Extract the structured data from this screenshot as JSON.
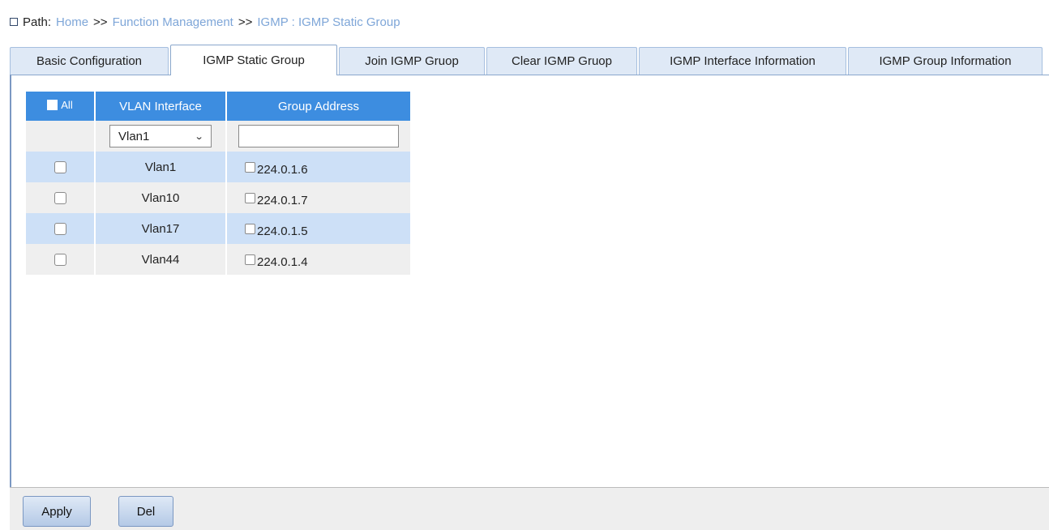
{
  "path": {
    "label": "Path:",
    "crumbs": [
      "Home",
      "Function Management",
      "IGMP : IGMP Static Group"
    ],
    "separator": ">>"
  },
  "tabs": [
    {
      "label": "Basic Configuration",
      "active": false
    },
    {
      "label": "IGMP Static Group",
      "active": true
    },
    {
      "label": "Join IGMP Gruop",
      "active": false
    },
    {
      "label": "Clear IGMP Gruop",
      "active": false
    },
    {
      "label": "IGMP Interface Information",
      "active": false
    },
    {
      "label": "IGMP Group Information",
      "active": false
    }
  ],
  "table": {
    "headers": {
      "all": "All",
      "vlan": "VLAN Interface",
      "group": "Group Address"
    },
    "input_row": {
      "vlan_select": "Vlan1",
      "group_input": ""
    },
    "rows": [
      {
        "vlan": "Vlan1",
        "group": "224.0.1.6"
      },
      {
        "vlan": "Vlan10",
        "group": "224.0.1.7"
      },
      {
        "vlan": "Vlan17",
        "group": "224.0.1.5"
      },
      {
        "vlan": "Vlan44",
        "group": "224.0.1.4"
      }
    ]
  },
  "buttons": {
    "apply": "Apply",
    "del": "Del"
  },
  "colors": {
    "header_blue": "#3d8de0",
    "row_highlight": "#cde0f7",
    "link": "#7ea6d8"
  }
}
